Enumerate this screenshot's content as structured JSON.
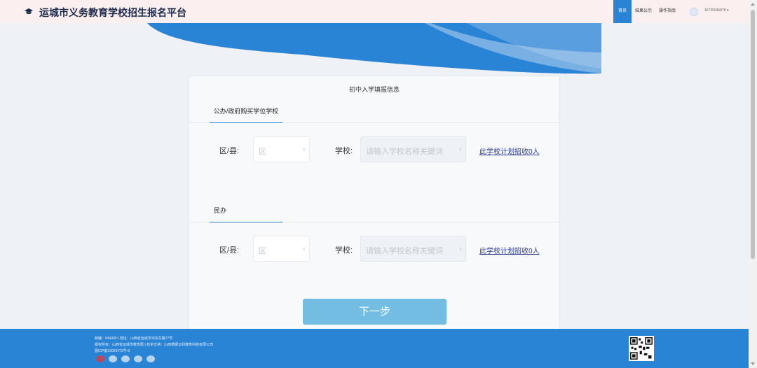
{
  "header": {
    "title": "运城市义务教育学校招生报名平台",
    "nav": [
      {
        "label": "首页",
        "active": true
      },
      {
        "label": "结果公示",
        "active": false
      },
      {
        "label": "操作指南",
        "active": false
      }
    ],
    "user_phone": "15735945878",
    "user_caret": "▾"
  },
  "card": {
    "title": "初中入学填报信息",
    "sections": [
      {
        "tab": "公办/政府购买学位学校",
        "district_label": "区/县:",
        "district_placeholder": "区",
        "school_label": "学校:",
        "school_placeholder": "请输入学校名称关键词",
        "plan_link": "此学校计划招收0人"
      },
      {
        "tab": "民办",
        "district_label": "区/县:",
        "district_placeholder": "区",
        "school_label": "学校:",
        "school_placeholder": "请输入学校名称关键词",
        "plan_link": "此学校计划招收0人"
      }
    ],
    "next_button": "下一步"
  },
  "footer": {
    "line1": "邮编：044000 | 地址：山西省运城市河东东路77号",
    "line2": "版权所有：山西省运城市教育局 | 技术支持：山西德振云科教育科技有限公司",
    "line3": "晋ICP备13003473号-8"
  },
  "icons": {
    "select_arrow": "⇕",
    "logo": "graduation-cap-icon"
  },
  "colors": {
    "accent": "#2a84d6",
    "header_bg": "#fbeff0",
    "button": "#74bde2",
    "link": "#2d3b8f"
  }
}
